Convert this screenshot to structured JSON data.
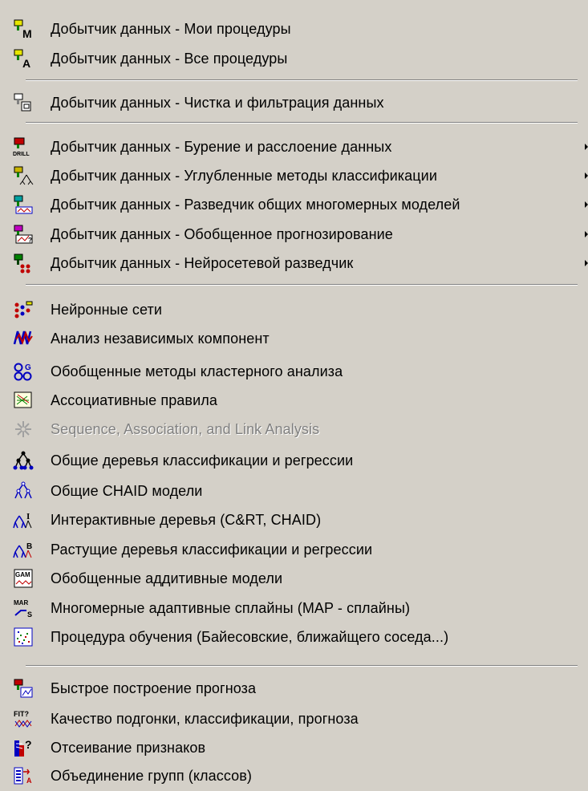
{
  "menu": {
    "items": [
      {
        "label": "Добытчик данных - Мои процедуры",
        "icon": "dm-my-procedures-icon",
        "disabled": false,
        "submenu": false
      },
      {
        "label": "Добытчик данных - Все процедуры",
        "icon": "dm-all-procedures-icon",
        "disabled": false,
        "submenu": false
      },
      {
        "label": "Добытчик данных - Чистка и фильтрация данных",
        "icon": "dm-data-cleaning-icon",
        "disabled": false,
        "submenu": false
      },
      {
        "label": "Добытчик данных - Бурение и расслоение данных",
        "icon": "dm-drill-icon",
        "disabled": false,
        "submenu": true
      },
      {
        "label": "Добытчик данных - Углубленные методы классификации",
        "icon": "dm-classification-icon",
        "disabled": false,
        "submenu": true
      },
      {
        "label": "Добытчик данных - Разведчик общих многомерных моделей",
        "icon": "dm-multivariate-explorer-icon",
        "disabled": false,
        "submenu": true
      },
      {
        "label": "Добытчик данных - Обобщенное прогнозирование",
        "icon": "dm-forecasting-icon",
        "disabled": false,
        "submenu": true
      },
      {
        "label": "Добытчик данных - Нейросетевой разведчик",
        "icon": "dm-neural-explorer-icon",
        "disabled": false,
        "submenu": true
      },
      {
        "label": "Нейронные сети",
        "icon": "neural-networks-icon",
        "disabled": false,
        "submenu": false
      },
      {
        "label": "Анализ независимых компонент",
        "icon": "ica-icon",
        "disabled": false,
        "submenu": false
      },
      {
        "label": "Обобщенные методы кластерного анализа",
        "icon": "cluster-analysis-icon",
        "disabled": false,
        "submenu": false
      },
      {
        "label": "Ассоциативные правила",
        "icon": "association-rules-icon",
        "disabled": false,
        "submenu": false
      },
      {
        "label": "Sequence, Association, and Link Analysis",
        "icon": "sequence-analysis-icon",
        "disabled": true,
        "submenu": false
      },
      {
        "label": "Общие деревья классификации и регрессии",
        "icon": "classification-trees-icon",
        "disabled": false,
        "submenu": false
      },
      {
        "label": "Общие CHAID модели",
        "icon": "chaid-models-icon",
        "disabled": false,
        "submenu": false
      },
      {
        "label": "Интерактивные деревья (C&RT, CHAID)",
        "icon": "interactive-trees-icon",
        "disabled": false,
        "submenu": false
      },
      {
        "label": "Растущие деревья классификации и регрессии",
        "icon": "boosted-trees-icon",
        "disabled": false,
        "submenu": false
      },
      {
        "label": "Обобщенные аддитивные модели",
        "icon": "gam-icon",
        "disabled": false,
        "submenu": false
      },
      {
        "label": "Многомерные адаптивные сплайны (MAP - сплайны)",
        "icon": "mars-splines-icon",
        "disabled": false,
        "submenu": false
      },
      {
        "label": "Процедура обучения (Байесовские, ближайщего соседа...)",
        "icon": "machine-learning-icon",
        "disabled": false,
        "submenu": false
      },
      {
        "label": "Быстрое построение прогноза",
        "icon": "rapid-deployment-icon",
        "disabled": false,
        "submenu": false
      },
      {
        "label": "Качество подгонки, классификации, прогноза",
        "icon": "goodness-of-fit-icon",
        "disabled": false,
        "submenu": false
      },
      {
        "label": "Отсеивание признаков",
        "icon": "feature-selection-icon",
        "disabled": false,
        "submenu": false
      },
      {
        "label": "Объединение групп (классов)",
        "icon": "combine-groups-icon",
        "disabled": false,
        "submenu": false
      }
    ]
  },
  "colors": {
    "menu_background": "#d4d0c8",
    "text": "#000000",
    "disabled_text": "#808080",
    "separator_dark": "#808080",
    "separator_light": "#ffffff"
  }
}
